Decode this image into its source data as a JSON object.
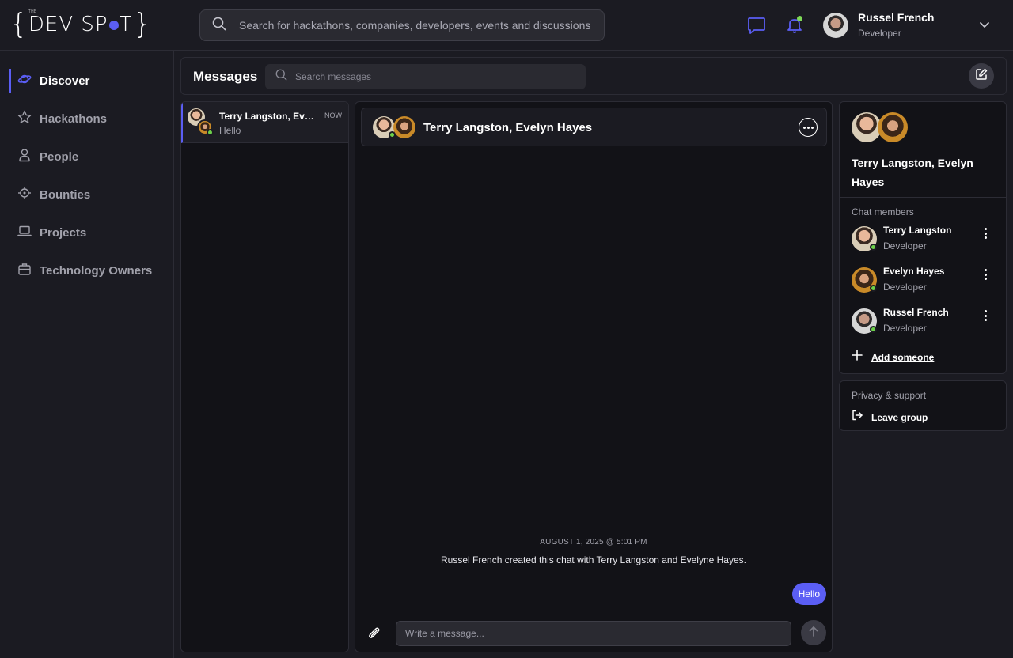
{
  "brand": {
    "logo_small": "THE",
    "logo_left": "DEV SP",
    "logo_right": "T",
    "accent_color": "#5b5ef4",
    "online_color": "#6dd14a"
  },
  "topbar": {
    "search_placeholder": "Search for hackathons, companies, developers, events and discussions",
    "icons": [
      "chat-icon",
      "bell-icon",
      "chevron-down-icon"
    ],
    "user": {
      "name": "Russel French",
      "role": "Developer"
    }
  },
  "sidebar": {
    "items": [
      {
        "label": "Discover",
        "icon": "planet-icon",
        "active": true
      },
      {
        "label": "Hackathons",
        "icon": "star-icon",
        "active": false
      },
      {
        "label": "People",
        "icon": "person-icon",
        "active": false
      },
      {
        "label": "Bounties",
        "icon": "target-icon",
        "active": false
      },
      {
        "label": "Projects",
        "icon": "laptop-icon",
        "active": false
      },
      {
        "label": "Technology Owners",
        "icon": "briefcase-icon",
        "active": false
      }
    ]
  },
  "messages": {
    "title": "Messages",
    "search_placeholder": "Search messages",
    "compose_icon": "compose-icon"
  },
  "conversations": [
    {
      "name": "Terry Langston, Evelyn Hayes",
      "time": "NOW",
      "preview": "Hello"
    }
  ],
  "chat": {
    "title": "Terry Langston, Evelyn Hayes",
    "system_date": "AUGUST 1, 2025 @ 5:01 PM",
    "system_message": "Russel French created this chat with Terry Langston and Evelyne Hayes.",
    "messages": [
      {
        "text": "Hello",
        "own": true
      }
    ],
    "input_placeholder": "Write a message..."
  },
  "info": {
    "title": "Terry Langston, Evelyn Hayes",
    "members_label": "Chat members",
    "members": [
      {
        "name": "Terry Langston",
        "role": "Developer"
      },
      {
        "name": "Evelyn Hayes",
        "role": "Developer"
      },
      {
        "name": "Russel French",
        "role": "Developer"
      }
    ],
    "add_label": "Add someone",
    "privacy_label": "Privacy & support",
    "leave_label": "Leave group"
  }
}
